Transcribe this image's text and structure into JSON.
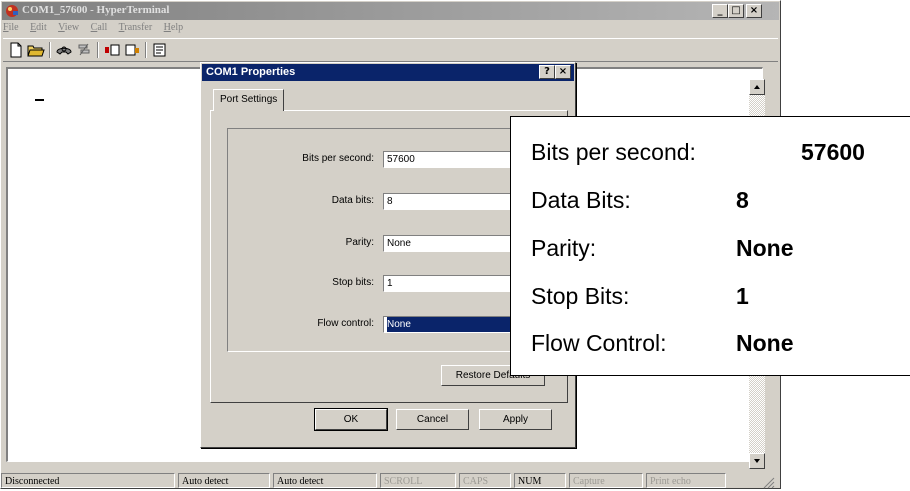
{
  "window": {
    "title": "COM1_57600 - HyperTerminal",
    "buttons": {
      "minimize": "_",
      "maximize": "□",
      "close": "×"
    }
  },
  "menu": [
    {
      "label": "File",
      "key": "F",
      "rest": "ile"
    },
    {
      "label": "Edit",
      "key": "E",
      "rest": "dit"
    },
    {
      "label": "View",
      "key": "V",
      "rest": "iew"
    },
    {
      "label": "Call",
      "key": "C",
      "rest": "all"
    },
    {
      "label": "Transfer",
      "key": "T",
      "rest": "ransfer"
    },
    {
      "label": "Help",
      "key": "H",
      "rest": "elp"
    }
  ],
  "toolbar_icons": [
    "new-document-icon",
    "open-folder-icon",
    "call-icon",
    "disconnect-icon",
    "send-icon",
    "receive-icon",
    "properties-icon"
  ],
  "statusbar": {
    "connection": "Disconnected",
    "detect1": "Auto detect",
    "detect2": "Auto detect",
    "scroll": "SCROLL",
    "caps": "CAPS",
    "num": "NUM",
    "capture": "Capture",
    "printecho": "Print echo"
  },
  "dialog": {
    "title": "COM1  Properties",
    "help_btn": "?",
    "close_btn": "×",
    "tab": "Port Settings",
    "fields": {
      "bps": {
        "label": "Bits per second:",
        "value": "57600"
      },
      "databits": {
        "label": "Data bits:",
        "value": "8"
      },
      "parity": {
        "label": "Parity:",
        "value": "None"
      },
      "stopbits": {
        "label": "Stop bits:",
        "value": "1"
      },
      "flow": {
        "label": "Flow control:",
        "value": "None"
      }
    },
    "restore": "Restore Defaults",
    "ok": "OK",
    "cancel": "Cancel",
    "apply": "Apply"
  },
  "callout": {
    "rows": [
      {
        "label": "Bits per second:",
        "value": "57600"
      },
      {
        "label": "Data Bits:",
        "value": "8"
      },
      {
        "label": "Parity:",
        "value": "None"
      },
      {
        "label": "Stop Bits:",
        "value": "1"
      },
      {
        "label": "Flow Control:",
        "value": "None"
      }
    ]
  },
  "colors": {
    "window_face": "#d4d0c8",
    "dialog_title": "#0a246a",
    "inactive_title": "#808080"
  }
}
